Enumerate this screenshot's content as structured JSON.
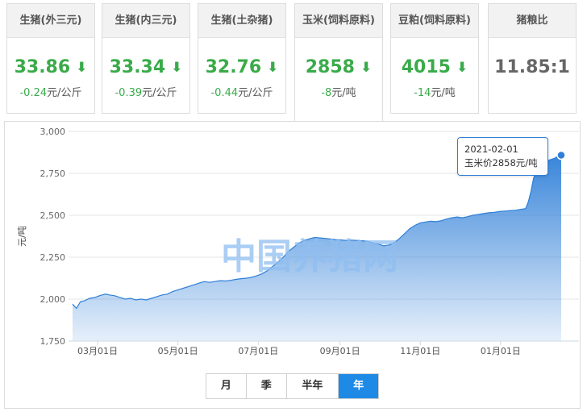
{
  "cards": [
    {
      "title": "生猪(外三元)",
      "price": "33.86",
      "change": "-0.24",
      "unit": "元/公斤",
      "trend_icon": "arrow-down-icon",
      "color": "#3aab4a"
    },
    {
      "title": "生猪(内三元)",
      "price": "33.34",
      "change": "-0.39",
      "unit": "元/公斤",
      "trend_icon": "arrow-down-icon",
      "color": "#3aab4a"
    },
    {
      "title": "生猪(土杂猪)",
      "price": "32.76",
      "change": "-0.44",
      "unit": "元/公斤",
      "trend_icon": "arrow-down-icon",
      "color": "#3aab4a"
    },
    {
      "title": "玉米(饲料原料)",
      "price": "2858",
      "change": "-8",
      "unit": "元/吨",
      "trend_icon": "arrow-down-icon",
      "color": "#3aab4a",
      "active": true
    },
    {
      "title": "豆粕(饲料原料)",
      "price": "4015",
      "change": "-14",
      "unit": "元/吨",
      "trend_icon": "arrow-down-icon",
      "color": "#3aab4a"
    },
    {
      "title": "猪粮比",
      "price": "11.85:1",
      "change": "",
      "unit": "",
      "color": "#666666"
    }
  ],
  "watermark": "中国养猪网",
  "tooltip": {
    "date": "2021-02-01",
    "text": "玉米价2858元/吨"
  },
  "range_buttons": [
    {
      "label": "月",
      "selected": false
    },
    {
      "label": "季",
      "selected": false
    },
    {
      "label": "半年",
      "selected": false
    },
    {
      "label": "年",
      "selected": true
    }
  ],
  "chart_data": {
    "type": "area",
    "ylabel": "元/吨",
    "ylim": [
      1750,
      3000
    ],
    "yticks": [
      "1,750",
      "2,000",
      "2,250",
      "2,500",
      "2,750",
      "3,000"
    ],
    "yticks_values": [
      1750,
      2000,
      2250,
      2500,
      2750,
      3000
    ],
    "xticks": [
      "03月01日",
      "05月01日",
      "07月01日",
      "09月01日",
      "11月01日",
      "01月01日"
    ],
    "xticks_days": [
      0,
      61,
      122,
      184,
      245,
      306
    ],
    "x_range_days": [
      -19,
      352
    ],
    "grid": true,
    "series": [
      {
        "color": "#2f7fd8",
        "points": [
          [
            -19,
            1970
          ],
          [
            -16,
            1945
          ],
          [
            -13,
            1985
          ],
          [
            -10,
            1990
          ],
          [
            -6,
            2005
          ],
          [
            -2,
            2010
          ],
          [
            2,
            2022
          ],
          [
            6,
            2030
          ],
          [
            9,
            2025
          ],
          [
            13,
            2020
          ],
          [
            17,
            2010
          ],
          [
            21,
            2000
          ],
          [
            25,
            2005
          ],
          [
            29,
            1995
          ],
          [
            33,
            2000
          ],
          [
            37,
            1995
          ],
          [
            41,
            2005
          ],
          [
            45,
            2015
          ],
          [
            49,
            2025
          ],
          [
            53,
            2030
          ],
          [
            57,
            2045
          ],
          [
            61,
            2055
          ],
          [
            65,
            2065
          ],
          [
            69,
            2075
          ],
          [
            73,
            2085
          ],
          [
            77,
            2095
          ],
          [
            81,
            2105
          ],
          [
            85,
            2100
          ],
          [
            89,
            2105
          ],
          [
            93,
            2110
          ],
          [
            97,
            2108
          ],
          [
            101,
            2112
          ],
          [
            105,
            2118
          ],
          [
            109,
            2122
          ],
          [
            113,
            2125
          ],
          [
            117,
            2130
          ],
          [
            121,
            2140
          ],
          [
            125,
            2152
          ],
          [
            129,
            2170
          ],
          [
            133,
            2195
          ],
          [
            137,
            2220
          ],
          [
            141,
            2250
          ],
          [
            145,
            2285
          ],
          [
            149,
            2310
          ],
          [
            153,
            2335
          ],
          [
            157,
            2350
          ],
          [
            161,
            2360
          ],
          [
            165,
            2368
          ],
          [
            169,
            2365
          ],
          [
            173,
            2362
          ],
          [
            177,
            2358
          ],
          [
            181,
            2355
          ],
          [
            185,
            2353
          ],
          [
            189,
            2350
          ],
          [
            193,
            2352
          ],
          [
            197,
            2350
          ],
          [
            201,
            2348
          ],
          [
            205,
            2345
          ],
          [
            209,
            2335
          ],
          [
            213,
            2330
          ],
          [
            217,
            2318
          ],
          [
            221,
            2322
          ],
          [
            225,
            2335
          ],
          [
            229,
            2360
          ],
          [
            233,
            2390
          ],
          [
            237,
            2420
          ],
          [
            241,
            2440
          ],
          [
            245,
            2455
          ],
          [
            249,
            2460
          ],
          [
            253,
            2465
          ],
          [
            257,
            2462
          ],
          [
            261,
            2468
          ],
          [
            265,
            2478
          ],
          [
            269,
            2485
          ],
          [
            273,
            2490
          ],
          [
            277,
            2485
          ],
          [
            281,
            2492
          ],
          [
            285,
            2500
          ],
          [
            289,
            2505
          ],
          [
            293,
            2510
          ],
          [
            297,
            2515
          ],
          [
            301,
            2518
          ],
          [
            305,
            2522
          ],
          [
            309,
            2525
          ],
          [
            313,
            2528
          ],
          [
            317,
            2530
          ],
          [
            321,
            2535
          ],
          [
            325,
            2540
          ],
          [
            327,
            2580
          ],
          [
            329,
            2640
          ],
          [
            331,
            2720
          ],
          [
            333,
            2760
          ],
          [
            335,
            2790
          ],
          [
            337,
            2805
          ],
          [
            339,
            2815
          ],
          [
            341,
            2825
          ],
          [
            343,
            2830
          ],
          [
            345,
            2835
          ],
          [
            347,
            2840
          ],
          [
            349,
            2850
          ],
          [
            352,
            2858
          ]
        ]
      }
    ],
    "highlight_point": {
      "day": 352,
      "value": 2858
    }
  }
}
